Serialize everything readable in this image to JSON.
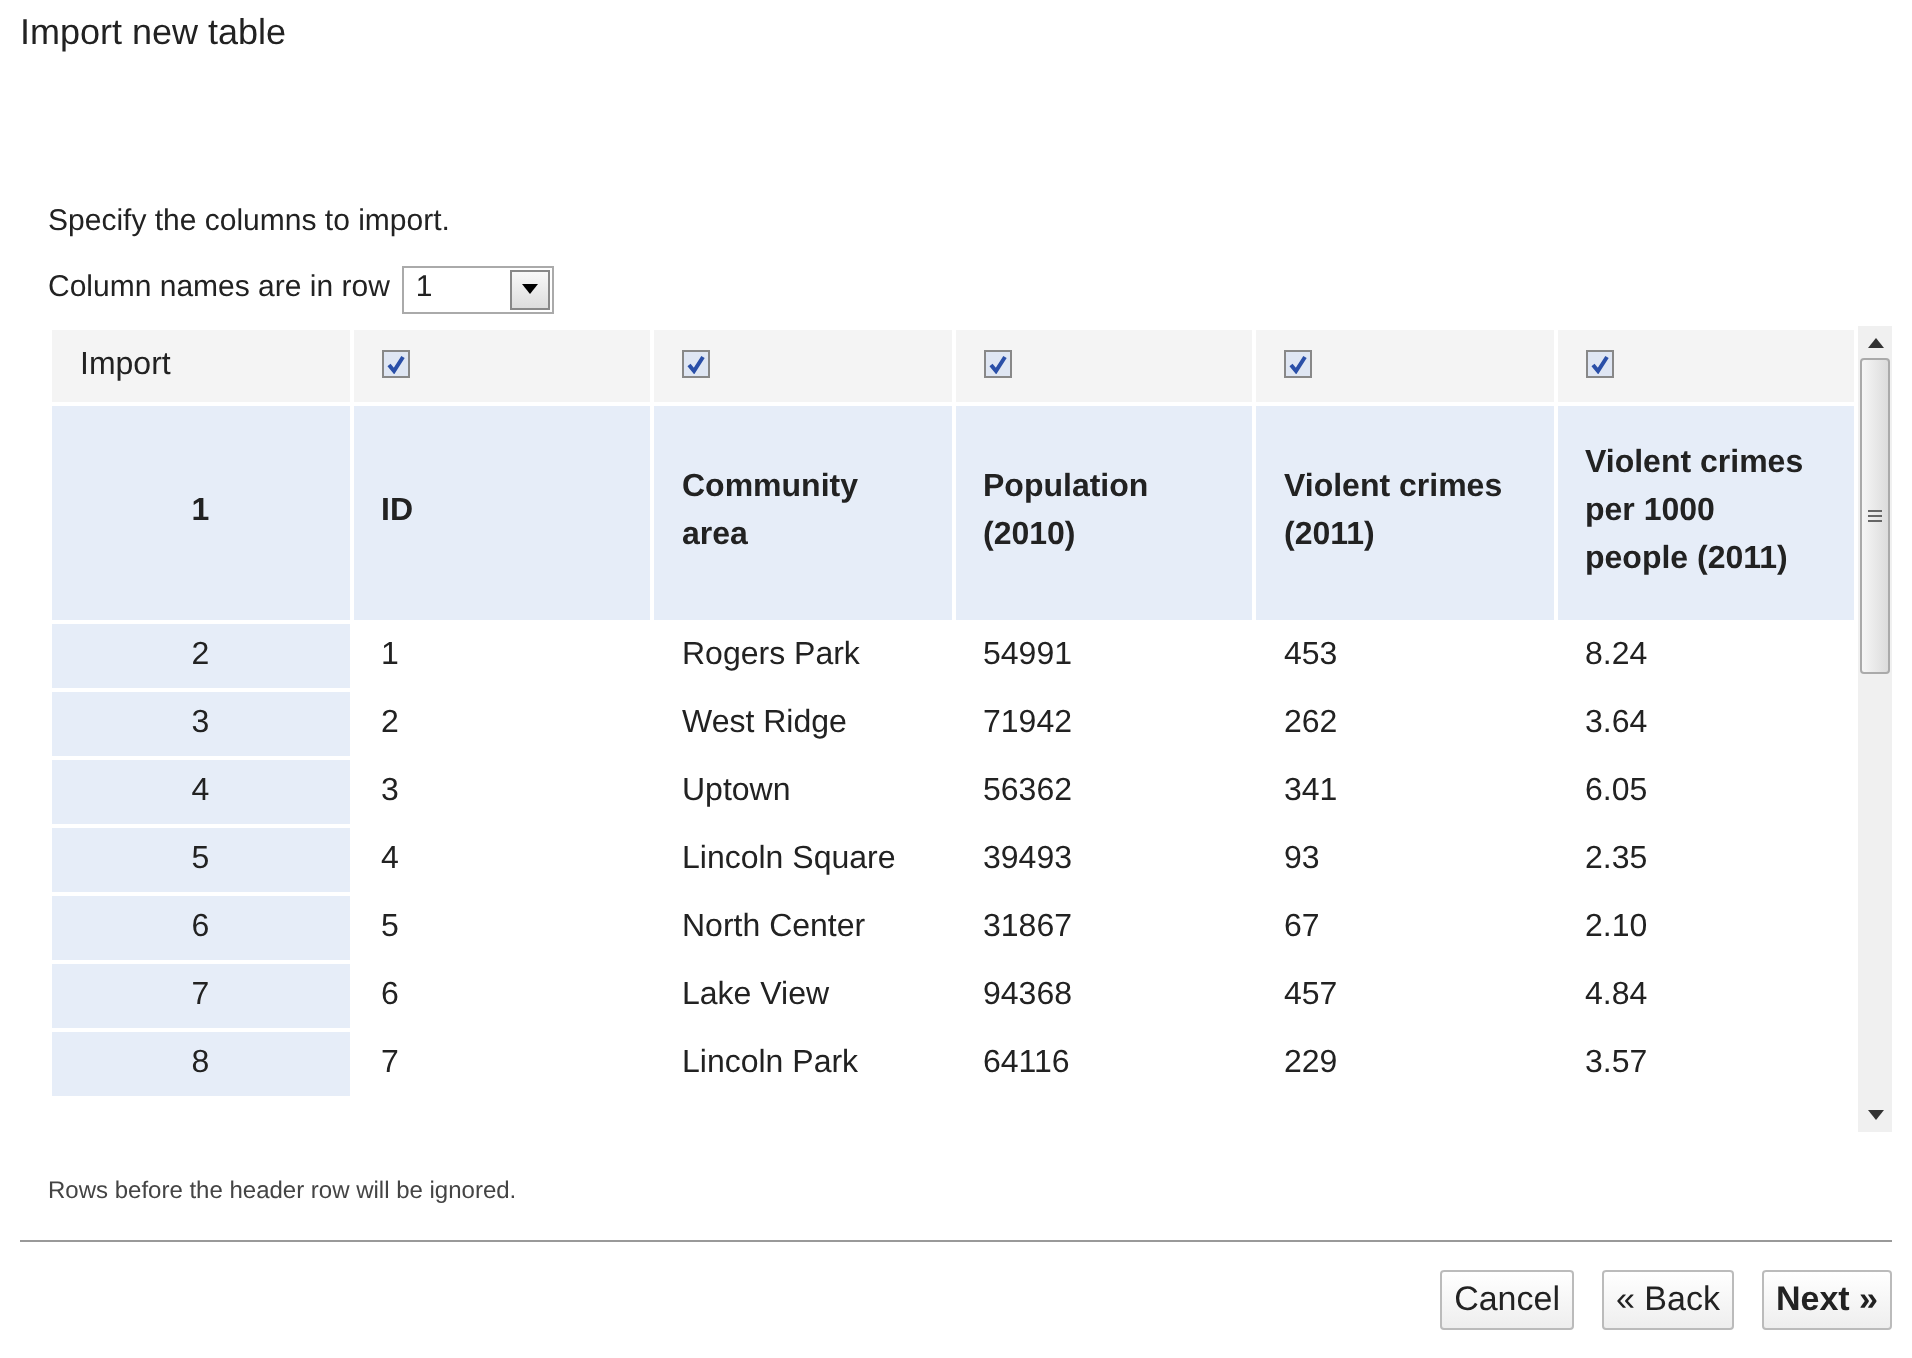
{
  "title": "Import new table",
  "instruction": "Specify the columns to import.",
  "header_row": {
    "label": "Column names are in row",
    "value": "1"
  },
  "import_label": "Import",
  "columns": [
    {
      "checked": true
    },
    {
      "checked": true
    },
    {
      "checked": true
    },
    {
      "checked": true
    },
    {
      "checked": true
    }
  ],
  "header": {
    "row_number": "1",
    "cells": [
      "ID",
      "Community area",
      "Population (2010)",
      "Violent crimes (2011)",
      "Violent crimes per 1000 people (2011)"
    ]
  },
  "rows": [
    {
      "row_number": "2",
      "cells": [
        "1",
        "Rogers Park",
        "54991",
        "453",
        "8.24"
      ]
    },
    {
      "row_number": "3",
      "cells": [
        "2",
        "West Ridge",
        "71942",
        "262",
        "3.64"
      ]
    },
    {
      "row_number": "4",
      "cells": [
        "3",
        "Uptown",
        "56362",
        "341",
        "6.05"
      ]
    },
    {
      "row_number": "5",
      "cells": [
        "4",
        "Lincoln Square",
        "39493",
        "93",
        "2.35"
      ]
    },
    {
      "row_number": "6",
      "cells": [
        "5",
        "North Center",
        "31867",
        "67",
        "2.10"
      ]
    },
    {
      "row_number": "7",
      "cells": [
        "6",
        "Lake View",
        "94368",
        "457",
        "4.84"
      ]
    },
    {
      "row_number": "8",
      "cells": [
        "7",
        "Lincoln Park",
        "64116",
        "229",
        "3.57"
      ]
    }
  ],
  "note": "Rows before the header row will be ignored.",
  "buttons": [
    {
      "label": "Cancel",
      "kind": "plain"
    },
    {
      "label": "« Back",
      "kind": "plain"
    },
    {
      "label": "Next »",
      "kind": "primary"
    }
  ]
}
